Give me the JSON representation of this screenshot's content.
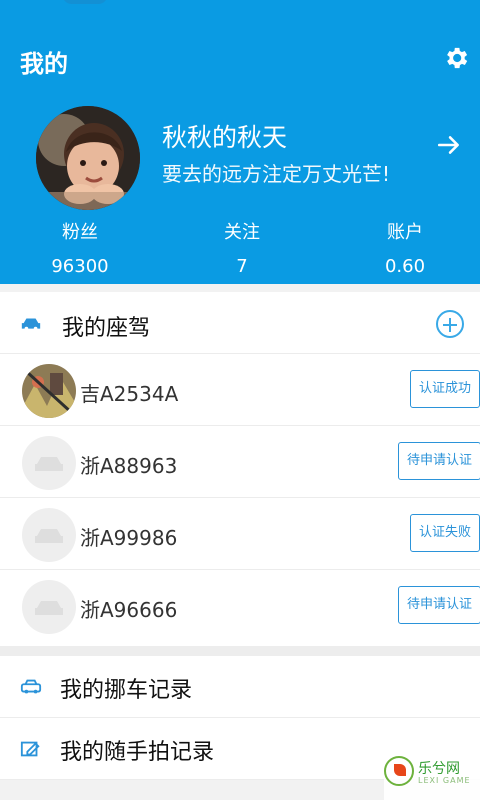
{
  "header": {
    "title": "我的",
    "settings_icon": "gear-icon",
    "accent_color": "#0a9be3",
    "user": {
      "name": "秋秋的秋天",
      "motto": "要去的远方注定万丈光芒!"
    },
    "stats": [
      {
        "label": "粉丝",
        "value": "96300"
      },
      {
        "label": "关注",
        "value": "7"
      },
      {
        "label": "账户",
        "value": "0.60"
      }
    ]
  },
  "cars": {
    "title": "我的座驾",
    "items": [
      {
        "plate": "吉A2534A",
        "status": "认证成功"
      },
      {
        "plate": "浙A88963",
        "status": "待申请认证"
      },
      {
        "plate": "浙A99986",
        "status": "认证失败"
      },
      {
        "plate": "浙A96666",
        "status": "待申请认证"
      }
    ]
  },
  "menu": {
    "items": [
      {
        "label": "我的挪车记录",
        "icon": "car-icon"
      },
      {
        "label": "我的随手拍记录",
        "icon": "edit-icon"
      }
    ]
  },
  "watermark": {
    "text": "乐兮网",
    "sub": "LEXI GAME"
  }
}
